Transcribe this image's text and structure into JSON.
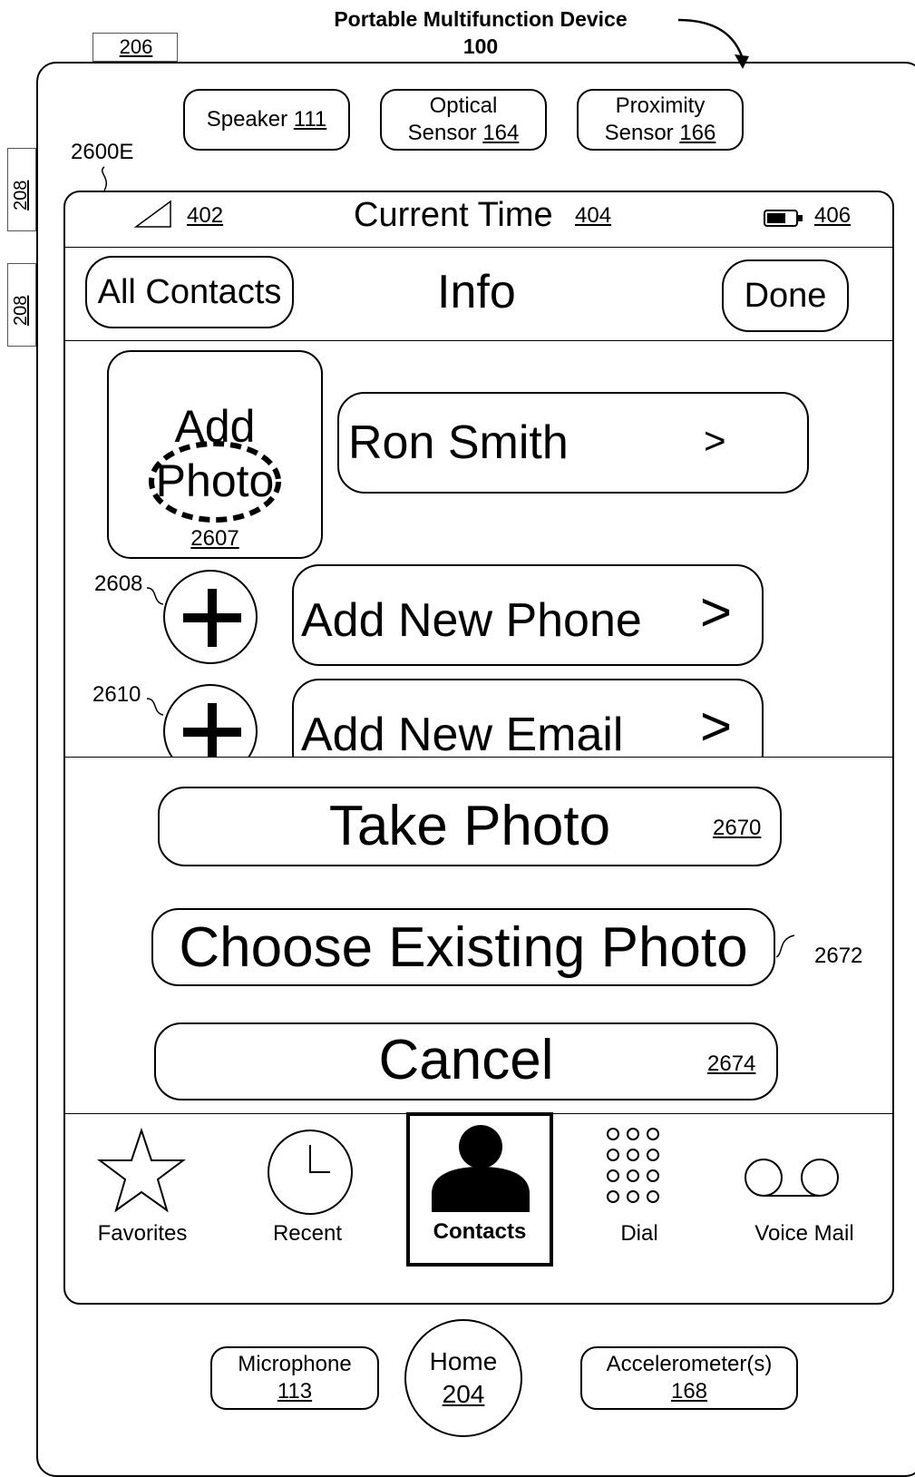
{
  "device": {
    "title": "Portable Multifunction Device",
    "ref": "100",
    "side_button_top_ref": "206",
    "side_button_refs": [
      "208",
      "208"
    ],
    "figure_ref": "2600E"
  },
  "sensors": {
    "speaker_label": "Speaker",
    "speaker_ref": "111",
    "optical_label": "Optical",
    "optical_label2": "Sensor",
    "optical_ref": "164",
    "proximity_label": "Proximity",
    "proximity_label2": "Sensor",
    "proximity_ref": "166"
  },
  "status_bar": {
    "signal_ref": "402",
    "time_label": "Current Time",
    "time_ref": "404",
    "battery_ref": "406"
  },
  "nav": {
    "back_label": "All Contacts",
    "title": "Info",
    "done_label": "Done"
  },
  "contact": {
    "add_photo_line1": "Add",
    "add_photo_line2": "Photo",
    "add_photo_ref": "2607",
    "name": "Ron Smith",
    "name_chevron": ">",
    "add_phone_ref": "2608",
    "add_phone_label": "Add New Phone",
    "add_phone_chevron": ">",
    "add_email_ref": "2610",
    "add_email_label": "Add New Email",
    "add_email_chevron": ">"
  },
  "action_sheet": {
    "take_photo_label": "Take Photo",
    "take_photo_ref": "2670",
    "choose_photo_label": "Choose Existing Photo",
    "choose_photo_ref": "2672",
    "cancel_label": "Cancel",
    "cancel_ref": "2674"
  },
  "tabs": [
    {
      "label": "Favorites",
      "icon": "star-icon",
      "selected": false
    },
    {
      "label": "Recent",
      "icon": "clock-icon",
      "selected": false
    },
    {
      "label": "Contacts",
      "icon": "person-icon",
      "selected": true
    },
    {
      "label": "Dial",
      "icon": "keypad-icon",
      "selected": false
    },
    {
      "label": "Voice Mail",
      "icon": "voicemail-icon",
      "selected": false
    }
  ],
  "hardware": {
    "microphone_label": "Microphone",
    "microphone_ref": "113",
    "home_label": "Home",
    "home_ref": "204",
    "accelerometer_label": "Accelerometer(s)",
    "accelerometer_ref": "168"
  }
}
